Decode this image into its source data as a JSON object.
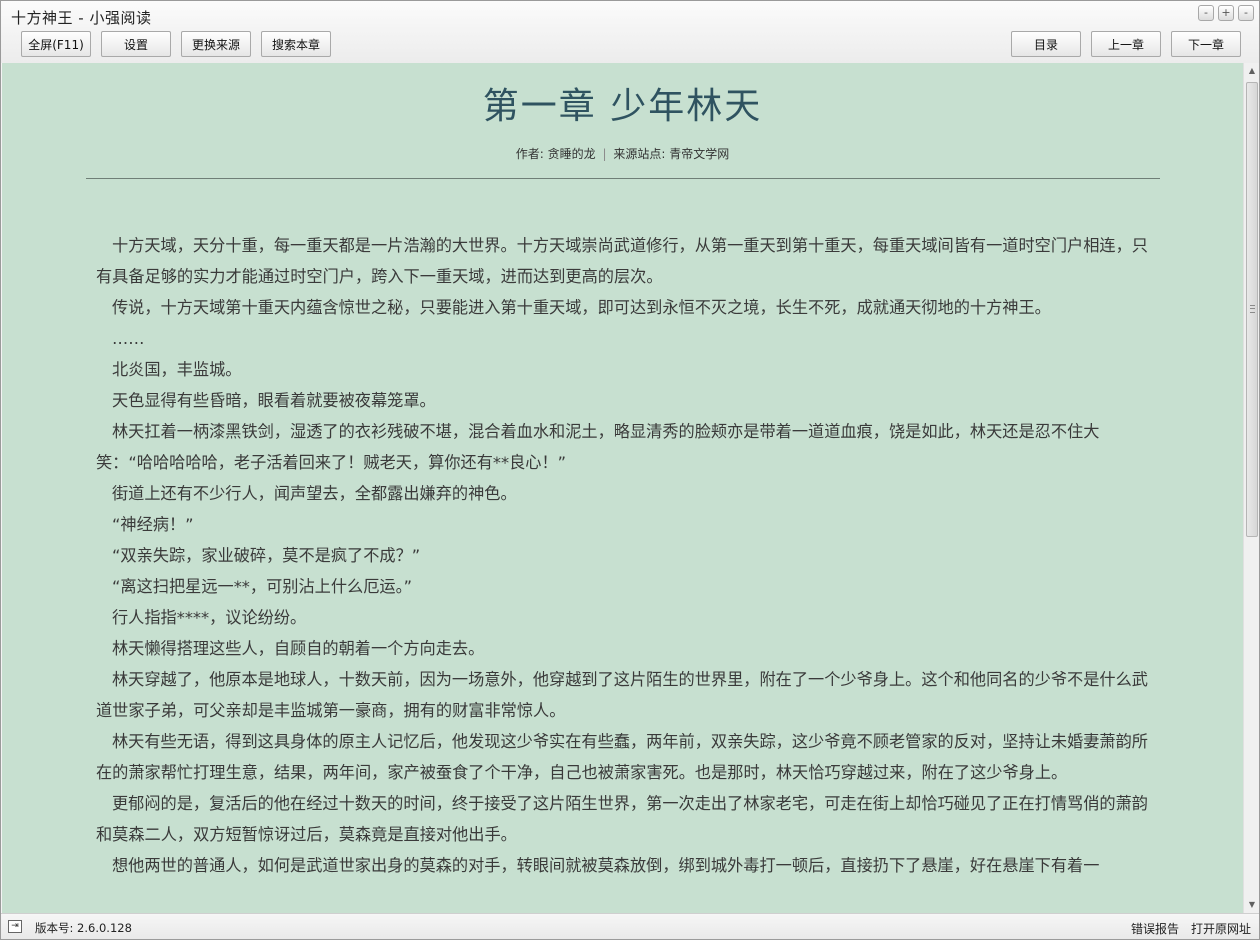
{
  "window": {
    "title": "十方神王 - 小强阅读",
    "controls": {
      "minimize": "-",
      "maximize": "+",
      "close": "-"
    }
  },
  "toolbar": {
    "fullscreen": "全屏(F11)",
    "settings": "设置",
    "change_source": "更换来源",
    "search_chapter": "搜索本章",
    "toc": "目录",
    "prev_chapter": "上一章",
    "next_chapter": "下一章"
  },
  "chapter": {
    "title": "第一章  少年林天",
    "author_label": "作者:",
    "author": "贪睡的龙",
    "separator": "|",
    "source_label": "来源站点:",
    "source": "青帝文学网",
    "paragraphs": [
      "十方天域，天分十重，每一重天都是一片浩瀚的大世界。十方天域崇尚武道修行，从第一重天到第十重天，每重天域间皆有一道时空门户相连，只有具备足够的实力才能通过时空门户，跨入下一重天域，进而达到更高的层次。",
      "传说，十方天域第十重天内蕴含惊世之秘，只要能进入第十重天域，即可达到永恒不灭之境，长生不死，成就通天彻地的十方神王。",
      "……",
      "北炎国，丰监城。",
      "天色显得有些昏暗，眼看着就要被夜幕笼罩。",
      "林天扛着一柄漆黑铁剑，湿透了的衣衫残破不堪，混合着血水和泥土，略显清秀的脸颊亦是带着一道道血痕，饶是如此，林天还是忍不住大笑：“哈哈哈哈哈，老子活着回来了！贼老天，算你还有**良心！”",
      "街道上还有不少行人，闻声望去，全都露出嫌弃的神色。",
      "“神经病！”",
      "“双亲失踪，家业破碎，莫不是疯了不成？”",
      "“离这扫把星远一**，可别沾上什么厄运。”",
      "行人指指****，议论纷纷。",
      "林天懒得搭理这些人，自顾自的朝着一个方向走去。",
      "林天穿越了，他原本是地球人，十数天前，因为一场意外，他穿越到了这片陌生的世界里，附在了一个少爷身上。这个和他同名的少爷不是什么武道世家子弟，可父亲却是丰监城第一豪商，拥有的财富非常惊人。",
      "林天有些无语，得到这具身体的原主人记忆后，他发现这少爷实在有些蠢，两年前，双亲失踪，这少爷竟不顾老管家的反对，坚持让未婚妻萧韵所在的萧家帮忙打理生意，结果，两年间，家产被蚕食了个干净，自己也被萧家害死。也是那时，林天恰巧穿越过来，附在了这少爷身上。",
      "更郁闷的是，复活后的他在经过十数天的时间，终于接受了这片陌生世界，第一次走出了林家老宅，可走在街上却恰巧碰见了正在打情骂俏的萧韵和莫森二人，双方短暂惊讶过后，莫森竟是直接对他出手。",
      "想他两世的普通人，如何是武道世家出身的莫森的对手，转眼间就被莫森放倒，绑到城外毒打一顿后，直接扔下了悬崖，好在悬崖下有着一"
    ]
  },
  "scrollbar": {
    "up": "▲",
    "down": "▼"
  },
  "statusbar": {
    "collapse_icon": "⇥",
    "version": "版本号: 2.6.0.128",
    "report_error": "错误报告",
    "open_url": "打开原网址"
  }
}
